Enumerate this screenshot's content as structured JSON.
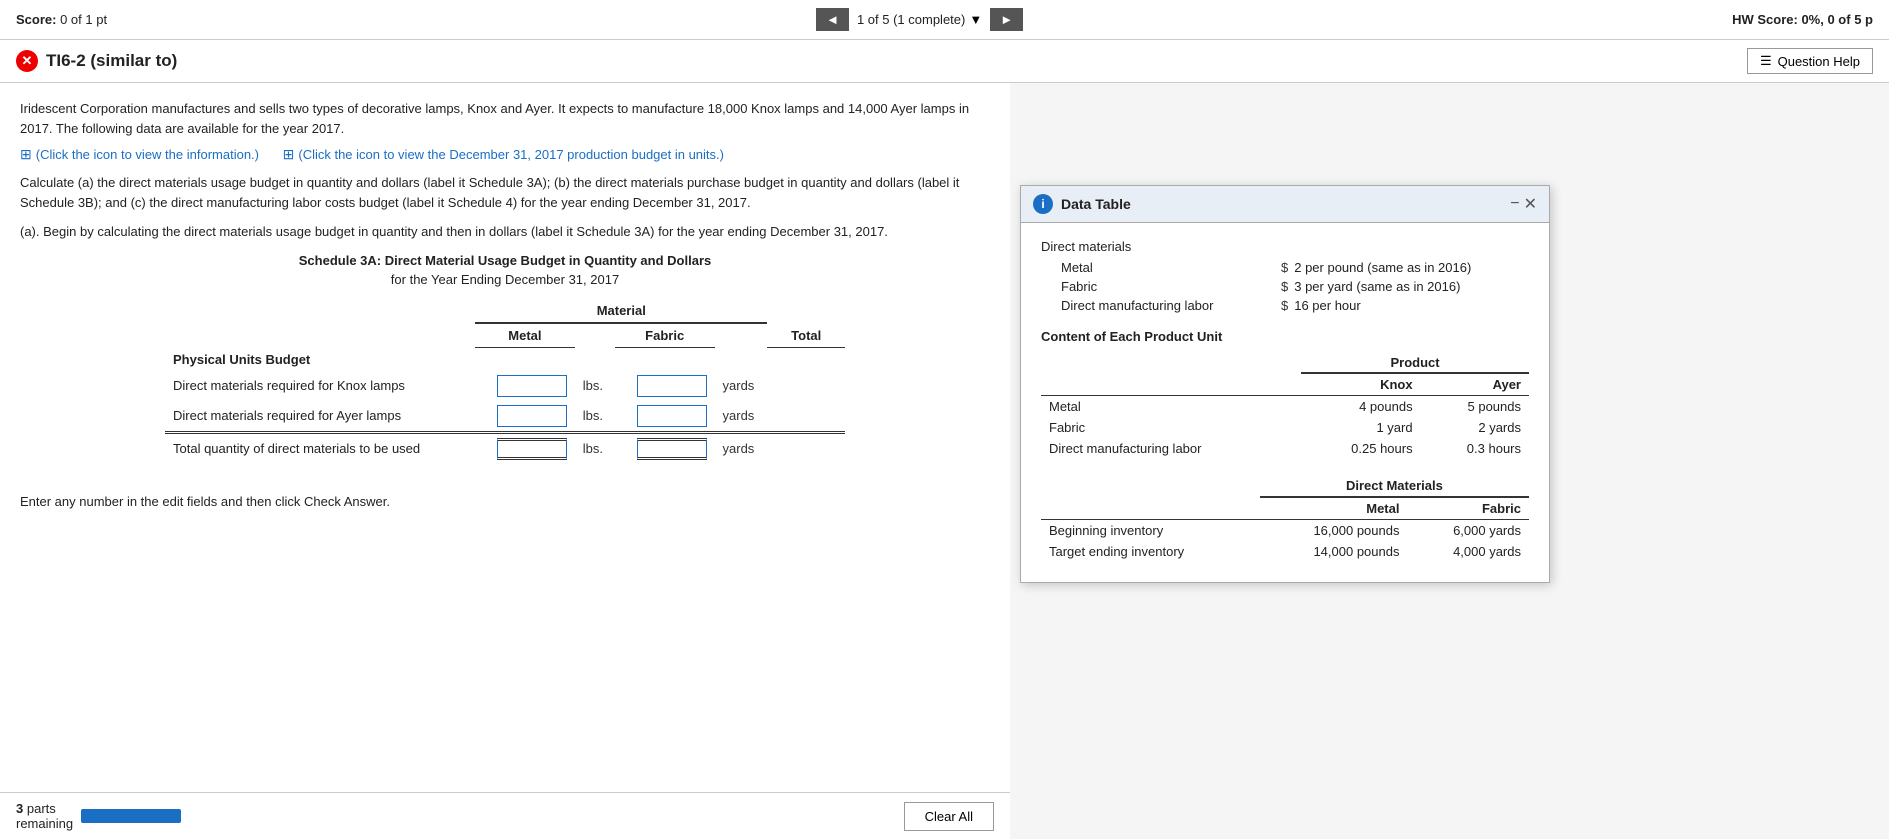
{
  "top_bar": {
    "score_label": "Score:",
    "score_value": "0 of 1 pt",
    "nav_prev": "◄",
    "nav_info": "1 of 5 (1 complete)",
    "nav_next": "►",
    "hw_score_label": "HW Score:",
    "hw_score_value": "0%, 0 of 5 p"
  },
  "title": "TI6-2 (similar to)",
  "question_help": "Question Help",
  "intro": "Iridescent Corporation manufactures and sells two types of decorative lamps, Knox and Ayer. It expects to manufacture 18,000 Knox lamps and 14,000 Ayer lamps in 2017. The following data are available for the year 2017.",
  "links": {
    "link1": "(Click the icon to view the information.)",
    "link2": "(Click the icon to view the December 31, 2017 production budget in units.)"
  },
  "instruction": "Calculate (a) the direct materials usage budget in quantity and dollars (label it Schedule 3A); (b) the direct materials purchase budget in quantity and dollars (label it Schedule 3B); and (c) the direct manufacturing labor costs budget (label it Schedule 4) for the year ending December 31, 2017.",
  "sub_question": "(a). Begin by calculating the direct materials usage budget in quantity and then in dollars (label it Schedule 3A) for the year ending December 31, 2017.",
  "schedule": {
    "title": "Schedule 3A: Direct Material Usage Budget in Quantity and Dollars",
    "subtitle": "for the Year Ending December 31, 2017",
    "material_header": "Material",
    "columns": [
      "Metal",
      "Fabric",
      "Total"
    ],
    "section": "Physical Units Budget",
    "rows": [
      {
        "label": "Direct materials required for Knox lamps",
        "unit1": "lbs.",
        "unit2": "yards"
      },
      {
        "label": "Direct materials required for Ayer lamps",
        "unit1": "lbs.",
        "unit2": "yards"
      },
      {
        "label": "Total quantity of direct materials to be used",
        "unit1": "lbs.",
        "unit2": "yards",
        "is_total": true
      }
    ]
  },
  "bottom": {
    "parts_remaining": "parts\nremaining",
    "clear_all": "Clear All",
    "parts_count": "3"
  },
  "data_table": {
    "title": "Data Table",
    "direct_materials_header": "Direct materials",
    "dm_rows": [
      {
        "label": "Metal",
        "dollar": "$",
        "value": "2 per pound (same as in 2016)"
      },
      {
        "label": "Fabric",
        "dollar": "$",
        "value": "3 per yard (same as in 2016)"
      },
      {
        "label": "Direct manufacturing labor",
        "dollar": "$",
        "value": "16 per hour"
      }
    ],
    "content_title": "Content of Each Product Unit",
    "product_header": "Product",
    "product_cols": [
      "Knox",
      "Ayer"
    ],
    "content_rows": [
      {
        "label": "Metal",
        "knox": "4 pounds",
        "ayer": "5 pounds"
      },
      {
        "label": "Fabric",
        "knox": "1 yard",
        "ayer": "2 yards"
      },
      {
        "label": "Direct manufacturing labor",
        "knox": "0.25 hours",
        "ayer": "0.3 hours"
      }
    ],
    "dm_section_header": "Direct Materials",
    "dm_cols": [
      "Metal",
      "Fabric"
    ],
    "dm_detail_rows": [
      {
        "label": "Beginning inventory",
        "metal": "16,000 pounds",
        "fabric": "6,000 yards"
      },
      {
        "label": "Target ending inventory",
        "metal": "14,000 pounds",
        "fabric": "4,000 yards"
      }
    ]
  }
}
